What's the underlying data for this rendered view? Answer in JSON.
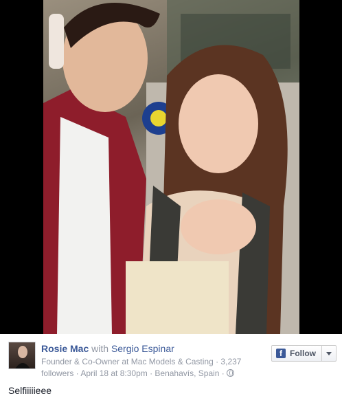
{
  "post": {
    "author": "Rosie Mac",
    "with_word": "with",
    "tagged": "Sergio Espinar",
    "subtitle_1": "Founder & Co-Owner at Mac Models & Casting · 3,237",
    "subtitle_2": "followers · April 18 at 8:30pm · Benahavís, Spain ·",
    "caption": "Selfiiiiieee",
    "privacy_icon": "globe-icon"
  },
  "follow": {
    "logo": "f",
    "label": "Follow"
  },
  "colors": {
    "link": "#3b5998",
    "muted": "#9197a3",
    "photo_border": "#000000"
  }
}
